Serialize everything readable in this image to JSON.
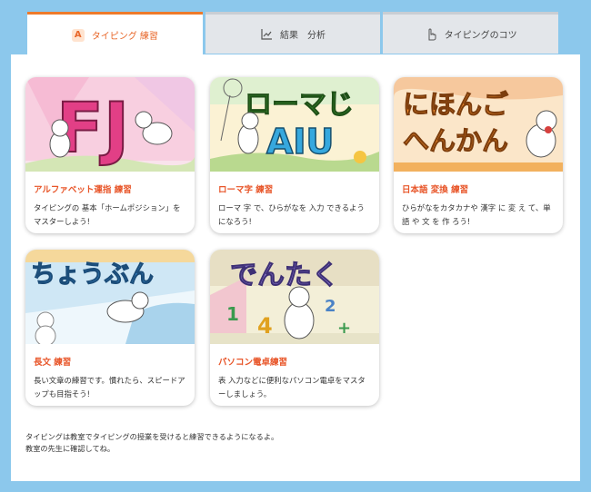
{
  "tabs": [
    {
      "label": "タイピング 練習",
      "icon": "letter-a-icon",
      "active": true
    },
    {
      "label": "結果　分析",
      "icon": "line-chart-icon",
      "active": false
    },
    {
      "label": "タイピングのコツ",
      "icon": "pointing-hand-icon",
      "active": false
    }
  ],
  "cards": [
    {
      "art_text": "FJ",
      "title": "アルファベット運指 練習",
      "desc": "タイピングの 基本「ホームポジション」をマスターしよう!"
    },
    {
      "art_text": "ローマじ",
      "art_sub": "AIU",
      "title": "ローマ字 練習",
      "desc": "ローマ 字 で、ひらがなを 入力 できるようになろう!"
    },
    {
      "art_text": "にほんご",
      "art_sub": "へんかん",
      "title": "日本語 変換 練習",
      "desc": "ひらがなをカタカナや 漢字 に 変 え て、単語 や 文 を 作 ろう!"
    },
    {
      "art_text": "ちょうぶん",
      "title": "長文 練習",
      "desc": "長い文章の練習です。慣れたら、スピードアップも目指そう!"
    },
    {
      "art_text": "でんたく",
      "art_digits": [
        "1",
        "4",
        "2",
        "+"
      ],
      "title": "パソコン電卓練習",
      "desc": "表 入力などに便利なパソコン電卓をマスターしましょう。"
    }
  ],
  "footer": {
    "line1": "タイピングは教室でタイピングの授業を受けると練習できるようになるよ。",
    "line2": "教室の先生に確認してね。"
  },
  "colors": {
    "accent": "#e8672a",
    "background": "#8cc8ec",
    "card_title": "#e8562a"
  }
}
